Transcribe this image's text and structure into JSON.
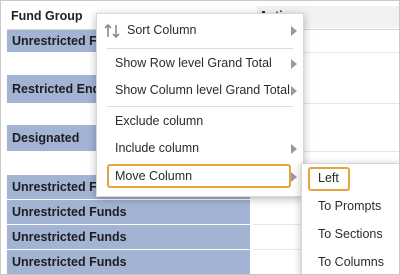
{
  "table": {
    "header": {
      "col1": "Fund Group",
      "col2": "Acti"
    },
    "rows": [
      {
        "label": "Unrestricted F"
      },
      {
        "label": "Restricted End"
      },
      {
        "label": "Designated"
      },
      {
        "label": "Unrestricted F"
      },
      {
        "label": "Unrestricted Funds"
      },
      {
        "label": "Unrestricted Funds"
      },
      {
        "label": "Unrestricted Funds"
      }
    ]
  },
  "context_menu": {
    "items": [
      {
        "label": "Sort Column",
        "icon": "sort-icon",
        "has_submenu": true
      },
      {
        "label": "Show Row level Grand Total",
        "has_submenu": true
      },
      {
        "label": "Show Column level Grand Total",
        "has_submenu": true
      },
      {
        "label": "Exclude column",
        "has_submenu": false
      },
      {
        "label": "Include column",
        "has_submenu": true
      },
      {
        "label": "Move Column",
        "has_submenu": true,
        "highlighted": true
      }
    ]
  },
  "submenu": {
    "items": [
      {
        "label": "Left",
        "highlighted": true
      },
      {
        "label": "To Prompts"
      },
      {
        "label": "To Sections"
      },
      {
        "label": "To Columns"
      }
    ]
  },
  "colors": {
    "row_fill": "#a3b3d3",
    "highlight_border": "#e6a33e"
  }
}
